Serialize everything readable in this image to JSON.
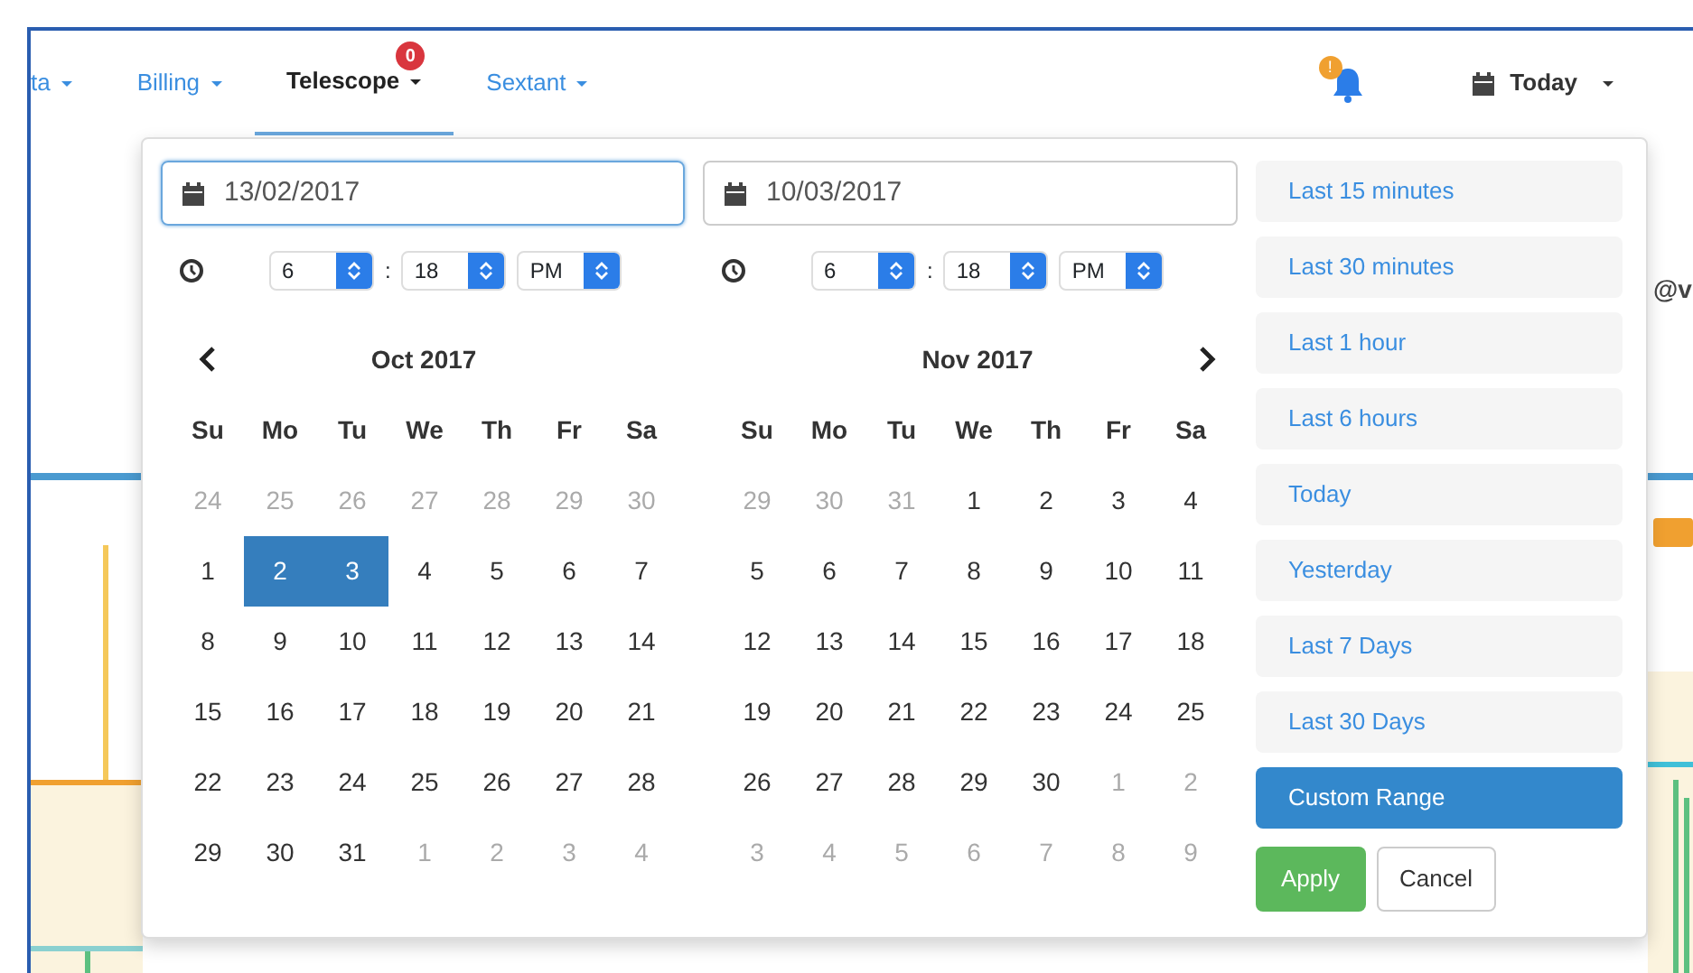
{
  "nav": {
    "items": [
      {
        "label": "ta",
        "selected": false
      },
      {
        "label": "Billing",
        "selected": false
      },
      {
        "label": "Telescope",
        "selected": true,
        "badge": "0"
      },
      {
        "label": "Sextant",
        "selected": false
      }
    ],
    "notifications": {
      "badge": "!"
    },
    "date_menu": {
      "label": "Today"
    }
  },
  "behind": {
    "text": "@v"
  },
  "picker": {
    "inputs": [
      {
        "value": "13/02/2017",
        "focused": true
      },
      {
        "value": "10/03/2017",
        "focused": false
      }
    ],
    "times": [
      {
        "hour": "6",
        "separator": ":",
        "minute": "18",
        "ampm": "PM"
      },
      {
        "hour": "6",
        "separator": ":",
        "minute": "18",
        "ampm": "PM"
      }
    ],
    "calendars": [
      {
        "title": "Oct 2017",
        "weekdays": [
          "Su",
          "Mo",
          "Tu",
          "We",
          "Th",
          "Fr",
          "Sa"
        ],
        "days": [
          {
            "label": "24",
            "off": true,
            "selected": false
          },
          {
            "label": "25",
            "off": true,
            "selected": false
          },
          {
            "label": "26",
            "off": true,
            "selected": false
          },
          {
            "label": "27",
            "off": true,
            "selected": false
          },
          {
            "label": "28",
            "off": true,
            "selected": false
          },
          {
            "label": "29",
            "off": true,
            "selected": false
          },
          {
            "label": "30",
            "off": true,
            "selected": false
          },
          {
            "label": "1",
            "off": false,
            "selected": false
          },
          {
            "label": "2",
            "off": false,
            "selected": true
          },
          {
            "label": "3",
            "off": false,
            "selected": true
          },
          {
            "label": "4",
            "off": false,
            "selected": false
          },
          {
            "label": "5",
            "off": false,
            "selected": false
          },
          {
            "label": "6",
            "off": false,
            "selected": false
          },
          {
            "label": "7",
            "off": false,
            "selected": false
          },
          {
            "label": "8",
            "off": false,
            "selected": false
          },
          {
            "label": "9",
            "off": false,
            "selected": false
          },
          {
            "label": "10",
            "off": false,
            "selected": false
          },
          {
            "label": "11",
            "off": false,
            "selected": false
          },
          {
            "label": "12",
            "off": false,
            "selected": false
          },
          {
            "label": "13",
            "off": false,
            "selected": false
          },
          {
            "label": "14",
            "off": false,
            "selected": false
          },
          {
            "label": "15",
            "off": false,
            "selected": false
          },
          {
            "label": "16",
            "off": false,
            "selected": false
          },
          {
            "label": "17",
            "off": false,
            "selected": false
          },
          {
            "label": "18",
            "off": false,
            "selected": false
          },
          {
            "label": "19",
            "off": false,
            "selected": false
          },
          {
            "label": "20",
            "off": false,
            "selected": false
          },
          {
            "label": "21",
            "off": false,
            "selected": false
          },
          {
            "label": "22",
            "off": false,
            "selected": false
          },
          {
            "label": "23",
            "off": false,
            "selected": false
          },
          {
            "label": "24",
            "off": false,
            "selected": false
          },
          {
            "label": "25",
            "off": false,
            "selected": false
          },
          {
            "label": "26",
            "off": false,
            "selected": false
          },
          {
            "label": "27",
            "off": false,
            "selected": false
          },
          {
            "label": "28",
            "off": false,
            "selected": false
          },
          {
            "label": "29",
            "off": false,
            "selected": false
          },
          {
            "label": "30",
            "off": false,
            "selected": false
          },
          {
            "label": "31",
            "off": false,
            "selected": false
          },
          {
            "label": "1",
            "off": true,
            "selected": false
          },
          {
            "label": "2",
            "off": true,
            "selected": false
          },
          {
            "label": "3",
            "off": true,
            "selected": false
          },
          {
            "label": "4",
            "off": true,
            "selected": false
          }
        ]
      },
      {
        "title": "Nov 2017",
        "weekdays": [
          "Su",
          "Mo",
          "Tu",
          "We",
          "Th",
          "Fr",
          "Sa"
        ],
        "days": [
          {
            "label": "29",
            "off": true,
            "selected": false
          },
          {
            "label": "30",
            "off": true,
            "selected": false
          },
          {
            "label": "31",
            "off": true,
            "selected": false
          },
          {
            "label": "1",
            "off": false,
            "selected": false
          },
          {
            "label": "2",
            "off": false,
            "selected": false
          },
          {
            "label": "3",
            "off": false,
            "selected": false
          },
          {
            "label": "4",
            "off": false,
            "selected": false
          },
          {
            "label": "5",
            "off": false,
            "selected": false
          },
          {
            "label": "6",
            "off": false,
            "selected": false
          },
          {
            "label": "7",
            "off": false,
            "selected": false
          },
          {
            "label": "8",
            "off": false,
            "selected": false
          },
          {
            "label": "9",
            "off": false,
            "selected": false
          },
          {
            "label": "10",
            "off": false,
            "selected": false
          },
          {
            "label": "11",
            "off": false,
            "selected": false
          },
          {
            "label": "12",
            "off": false,
            "selected": false
          },
          {
            "label": "13",
            "off": false,
            "selected": false
          },
          {
            "label": "14",
            "off": false,
            "selected": false
          },
          {
            "label": "15",
            "off": false,
            "selected": false
          },
          {
            "label": "16",
            "off": false,
            "selected": false
          },
          {
            "label": "17",
            "off": false,
            "selected": false
          },
          {
            "label": "18",
            "off": false,
            "selected": false
          },
          {
            "label": "19",
            "off": false,
            "selected": false
          },
          {
            "label": "20",
            "off": false,
            "selected": false
          },
          {
            "label": "21",
            "off": false,
            "selected": false
          },
          {
            "label": "22",
            "off": false,
            "selected": false
          },
          {
            "label": "23",
            "off": false,
            "selected": false
          },
          {
            "label": "24",
            "off": false,
            "selected": false
          },
          {
            "label": "25",
            "off": false,
            "selected": false
          },
          {
            "label": "26",
            "off": false,
            "selected": false
          },
          {
            "label": "27",
            "off": false,
            "selected": false
          },
          {
            "label": "28",
            "off": false,
            "selected": false
          },
          {
            "label": "29",
            "off": false,
            "selected": false
          },
          {
            "label": "30",
            "off": false,
            "selected": false
          },
          {
            "label": "1",
            "off": true,
            "selected": false
          },
          {
            "label": "2",
            "off": true,
            "selected": false
          },
          {
            "label": "3",
            "off": true,
            "selected": false
          },
          {
            "label": "4",
            "off": true,
            "selected": false
          },
          {
            "label": "5",
            "off": true,
            "selected": false
          },
          {
            "label": "6",
            "off": true,
            "selected": false
          },
          {
            "label": "7",
            "off": true,
            "selected": false
          },
          {
            "label": "8",
            "off": true,
            "selected": false
          },
          {
            "label": "9",
            "off": true,
            "selected": false
          }
        ]
      }
    ],
    "ranges": [
      {
        "label": "Last 15 minutes",
        "selected": false
      },
      {
        "label": "Last 30 minutes",
        "selected": false
      },
      {
        "label": "Last 1 hour",
        "selected": false
      },
      {
        "label": "Last 6 hours",
        "selected": false
      },
      {
        "label": "Today",
        "selected": false
      },
      {
        "label": "Yesterday",
        "selected": false
      },
      {
        "label": "Last 7 Days",
        "selected": false
      },
      {
        "label": "Last 30 Days",
        "selected": false
      },
      {
        "label": "Custom Range",
        "selected": true
      }
    ],
    "buttons": {
      "apply": "Apply",
      "cancel": "Cancel"
    }
  }
}
